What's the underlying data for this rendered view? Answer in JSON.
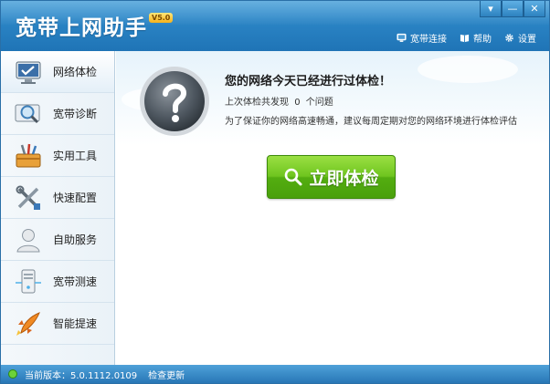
{
  "app": {
    "title": "宽带上网助手",
    "version_badge": "V5.0"
  },
  "window_controls": {
    "menu": "▾",
    "minimize": "—",
    "close": "✕"
  },
  "top_links": [
    {
      "label": "宽带连接",
      "icon": "monitor-icon"
    },
    {
      "label": "帮助",
      "icon": "book-icon"
    },
    {
      "label": "设置",
      "icon": "gear-icon"
    }
  ],
  "sidebar": {
    "items": [
      {
        "label": "网络体检",
        "icon": "monitor-check-icon",
        "active": true
      },
      {
        "label": "宽带诊断",
        "icon": "magnifier-icon",
        "active": false
      },
      {
        "label": "实用工具",
        "icon": "toolbox-icon",
        "active": false
      },
      {
        "label": "快速配置",
        "icon": "tools-icon",
        "active": false
      },
      {
        "label": "自助服务",
        "icon": "user-icon",
        "active": false
      },
      {
        "label": "宽带测速",
        "icon": "server-icon",
        "active": false
      },
      {
        "label": "智能提速",
        "icon": "rocket-icon",
        "active": false
      }
    ]
  },
  "main": {
    "headline": "您的网络今天已经进行过体检！",
    "last_check_prefix": "上次体检共发现",
    "last_check_count": "0",
    "last_check_suffix": "个问题",
    "advice": "为了保证你的网络高速畅通，建议每周定期对您的网络环境进行体检评估",
    "check_button": "立即体检"
  },
  "status": {
    "version_label": "当前版本：5.0.1112.0109",
    "update_link": "检查更新"
  },
  "colors": {
    "title_blue": "#2a83c4",
    "button_green": "#6fc51f",
    "status_blue": "#2877b6"
  }
}
